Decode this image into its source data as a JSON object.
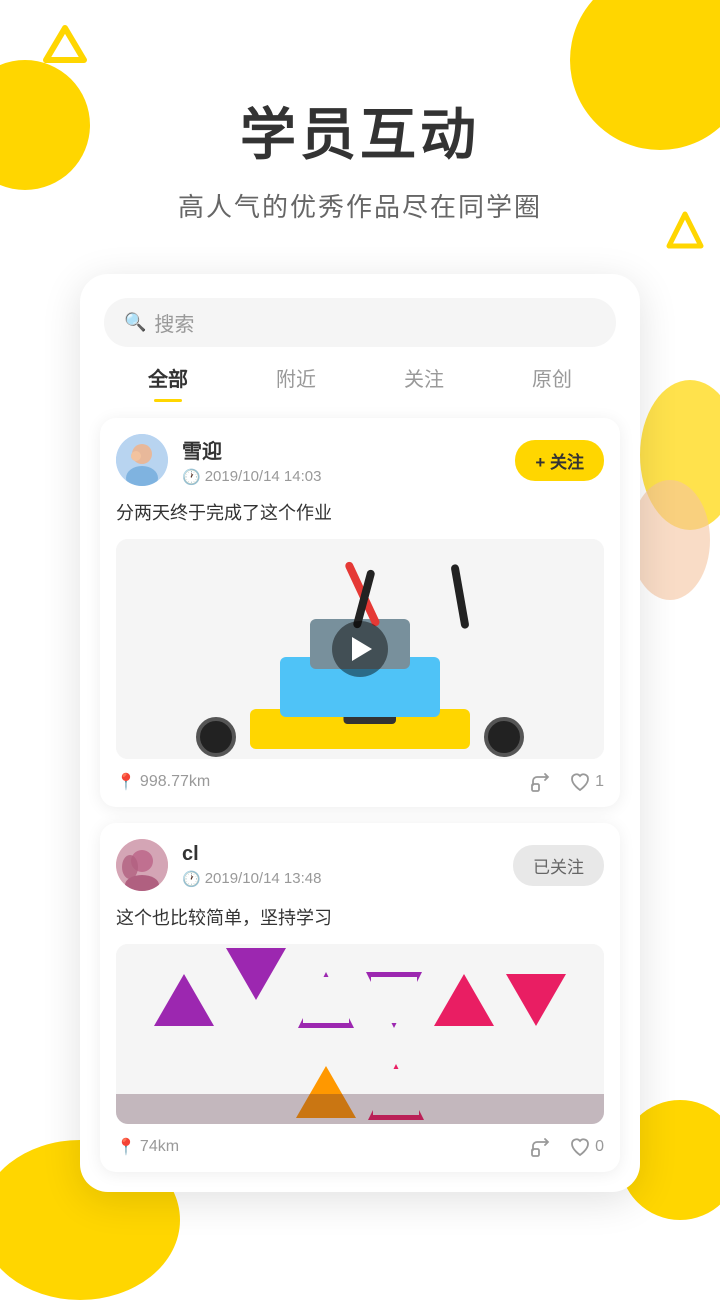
{
  "background": {
    "color": "#FFFFFF"
  },
  "header": {
    "title": "学员互动",
    "subtitle": "高人气的优秀作品尽在同学圈"
  },
  "search": {
    "placeholder": "搜索"
  },
  "tabs": [
    {
      "label": "全部",
      "active": true
    },
    {
      "label": "附近",
      "active": false
    },
    {
      "label": "关注",
      "active": false
    },
    {
      "label": "原创",
      "active": false
    }
  ],
  "posts": [
    {
      "id": 1,
      "user_name": "雪迎",
      "post_time": "2019/10/14 14:03",
      "follow_label": "+ 关注",
      "followed": false,
      "content": "分两天终于完成了这个作业",
      "location": "998.77km",
      "share_label": "",
      "like_count": "1",
      "has_video": true
    },
    {
      "id": 2,
      "user_name": "cl",
      "post_time": "2019/10/14 13:48",
      "follow_label": "已关注",
      "followed": true,
      "content": "这个也比较简单，坚持学习",
      "location": "74km",
      "share_label": "",
      "like_count": "0",
      "has_video": false
    }
  ],
  "icons": {
    "search": "🔍",
    "clock": "🕐",
    "location_pin": "📍",
    "share": "↗",
    "like": "👍",
    "play": "▶"
  }
}
